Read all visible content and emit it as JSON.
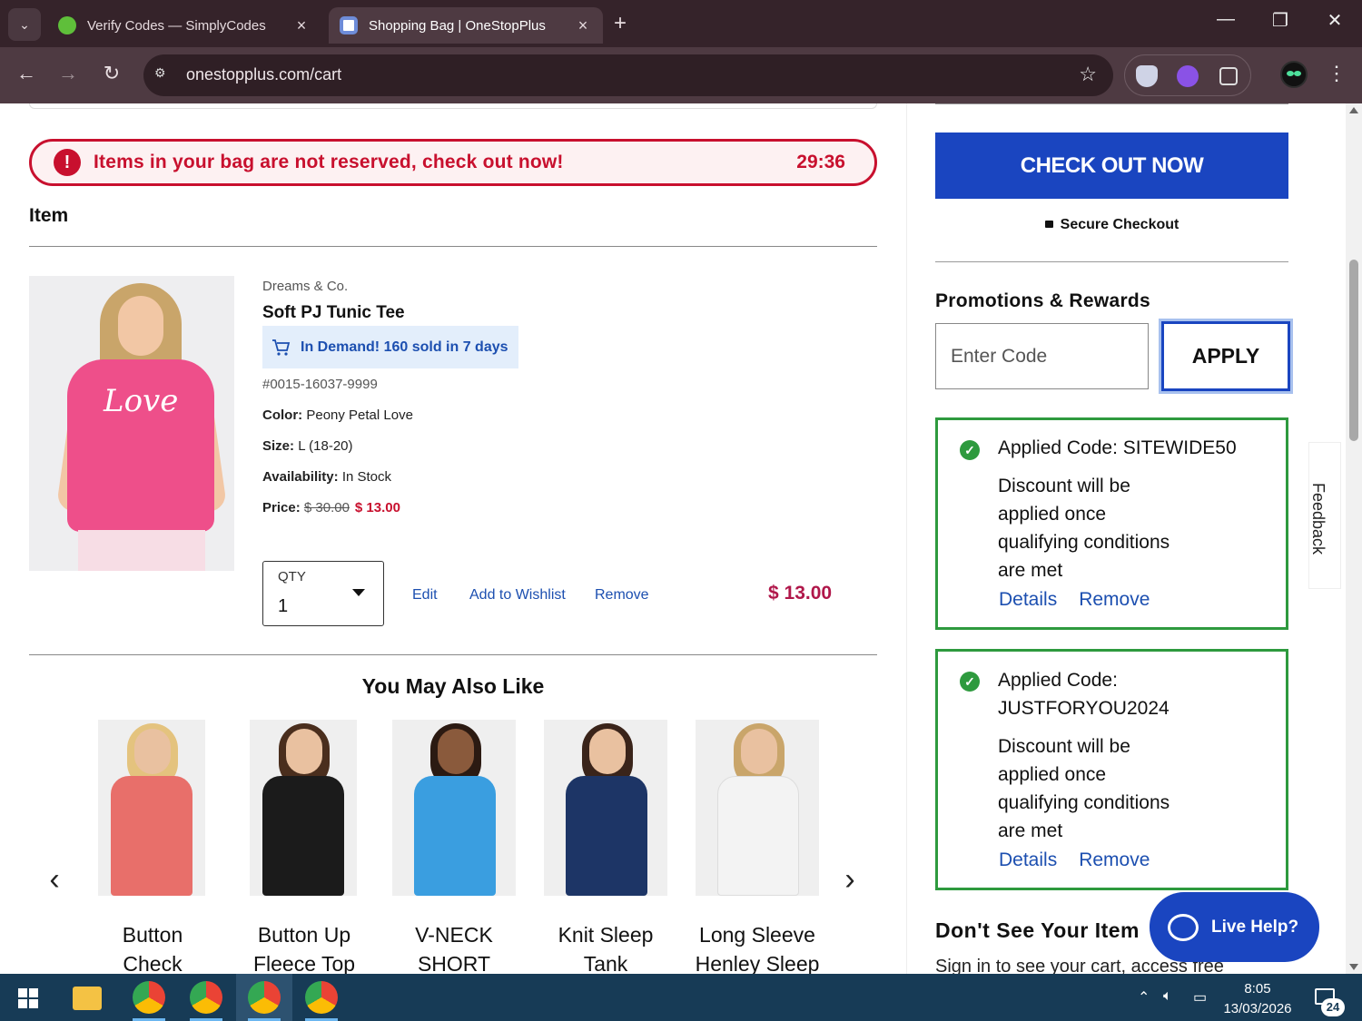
{
  "browser": {
    "tabs": [
      {
        "title": "Verify Codes — SimplyCodes"
      },
      {
        "title": "Shopping Bag | OneStopPlus"
      }
    ],
    "url": "onestopplus.com/cart"
  },
  "alert": {
    "message": "Items in your bag are not reserved, check out now!",
    "timer": "29:36"
  },
  "cart": {
    "column_header": "Item",
    "item": {
      "brand": "Dreams & Co.",
      "name": "Soft PJ Tunic Tee",
      "image_text": "Love",
      "demand_badge": "In Demand! 160 sold in 7 days",
      "sku": "#0015-16037-9999",
      "color_label": "Color:",
      "color": "Peony Petal Love",
      "size_label": "Size:",
      "size": "L (18-20)",
      "availability_label": "Availability:",
      "availability": "In Stock",
      "price_label": "Price:",
      "price_original": "$ 30.00",
      "price_sale": "$ 13.00",
      "qty_label": "QTY",
      "qty": "1",
      "edit": "Edit",
      "wishlist": "Add to Wishlist",
      "remove": "Remove",
      "line_total": "$ 13.00"
    }
  },
  "recommendations": {
    "title": "You May Also Like",
    "items": [
      {
        "line1": "Button",
        "line2": "Check",
        "color": "#e86f6a"
      },
      {
        "line1": "Button Up",
        "line2": "Fleece Top",
        "color": "#1b1b1b"
      },
      {
        "line1": "V-NECK",
        "line2": "SHORT",
        "color": "#3a9ee0"
      },
      {
        "line1": "Knit Sleep",
        "line2": "Tank",
        "color": "#1d3566"
      },
      {
        "line1": "Long Sleeve",
        "line2": "Henley Sleep",
        "color": "#f3f3f3"
      }
    ]
  },
  "sidebar": {
    "checkout": "CHECK OUT NOW",
    "secure": "Secure Checkout",
    "promo_title": "Promotions & Rewards",
    "code_placeholder": "Enter Code",
    "apply": "APPLY",
    "applied_codes": [
      {
        "line1": "Applied Code: SITEWIDE50",
        "line2": "",
        "desc": [
          "Discount will be",
          "applied once",
          "qualifying conditions",
          "are met"
        ]
      },
      {
        "line1": "Applied Code:",
        "line2": "JUSTFORYOU2024",
        "desc": [
          "Discount will be",
          "applied once",
          "qualifying conditions",
          "are met"
        ]
      }
    ],
    "details": "Details",
    "remove": "Remove",
    "dont_see": "Don't See Your Item",
    "signin": "Sign in to see your cart, access free"
  },
  "live_help": "Live Help?",
  "feedback": "Feedback",
  "taskbar": {
    "time": "8:05",
    "date": "13/03/2026",
    "notifications": "24"
  }
}
